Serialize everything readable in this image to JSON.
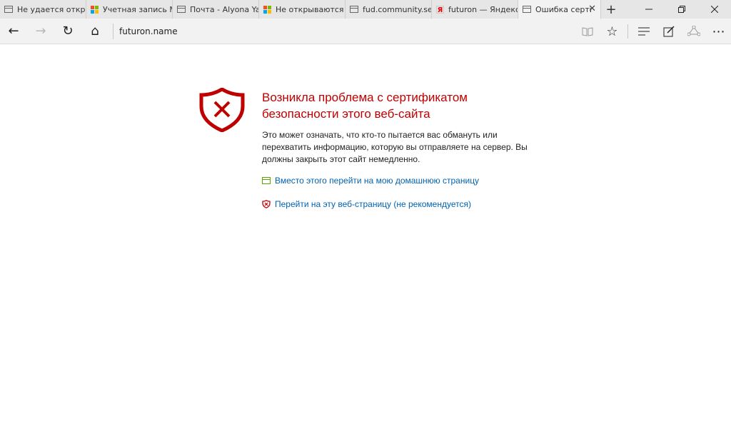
{
  "tabs": [
    {
      "title": "Не удается открыть",
      "icon": "page-icon"
    },
    {
      "title": "Учетная запись Mi",
      "icon": "microsoft-logo-icon"
    },
    {
      "title": "Почта - Alyona Yab",
      "icon": "page-icon"
    },
    {
      "title": "Не открываются h",
      "icon": "microsoft-logo-icon"
    },
    {
      "title": "fud.community.serv",
      "icon": "page-icon"
    },
    {
      "title": "futuron — Яндекс:",
      "icon": "yandex-icon"
    },
    {
      "title": "Ошибка сертиф",
      "icon": "page-icon",
      "active": true
    }
  ],
  "tab_close_glyph": "✕",
  "new_tab_glyph": "+",
  "window": {
    "minimize": "—",
    "restore": "❐",
    "close": "✕"
  },
  "nav": {
    "back": "←",
    "forward": "→",
    "refresh": "↻",
    "home": "⌂",
    "address": "futuron.name"
  },
  "tools": {
    "reading": "📖",
    "favorite": "☆",
    "hub": "≡",
    "note": "✎",
    "share": "◌",
    "more": "⋯"
  },
  "error": {
    "heading": "Возникла проблема с сертификатом безопасности этого веб-сайта",
    "description": "Это может означать, что кто-то пытается вас обмануть или перехватить информацию, которую вы отправляете на сервер. Вы должны закрыть этот сайт немедленно.",
    "home_link": "Вместо этого перейти на мою домашнюю страницу",
    "continue_link": "Перейти на эту веб-страницу (не рекомендуется)"
  },
  "colors": {
    "error_red": "#c00000",
    "link_blue": "#0063b1",
    "ms_red": "#f25022",
    "ms_green": "#7fba00",
    "ms_blue": "#00a4ef",
    "ms_yellow": "#ffb900"
  }
}
